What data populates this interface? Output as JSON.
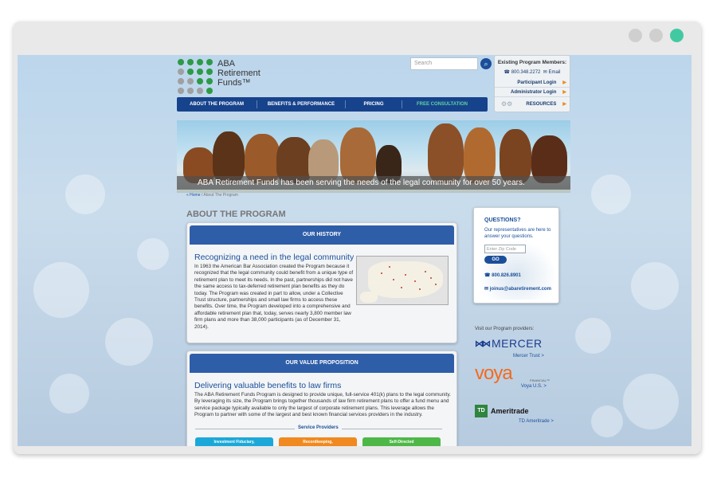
{
  "window": {
    "controls": [
      "window-dot",
      "window-dot",
      "window-dot-active"
    ]
  },
  "logo": {
    "line1": "ABA",
    "line2": "Retirement",
    "line3": "Funds™"
  },
  "search": {
    "placeholder": "Search"
  },
  "members": {
    "title": "Existing Program Members:",
    "phone": "800.348.2272",
    "email": "Email",
    "participant_login": "Participant Login",
    "administrator_login": "Administrator Login",
    "resources": "RESOURCES"
  },
  "nav": {
    "items": [
      "ABOUT THE PROGRAM",
      "BENEFITS & PERFORMANCE",
      "PRICING",
      "FREE CONSULTATION"
    ]
  },
  "hero": {
    "caption": "ABA Retirement Funds has been serving the needs of the legal community for over 50 years."
  },
  "breadcrumb": {
    "home": "« Home",
    "sep": "/",
    "current": "About The Program"
  },
  "page": {
    "title": "ABOUT THE PROGRAM"
  },
  "history": {
    "header": "OUR HISTORY",
    "title": "Recognizing a need in the legal community",
    "body": "In 1963 the American Bar Association created the Program because it recognized that the legal community could benefit from a unique type of retirement plan to meet its needs. In the past, partnerships did not have the same access to tax-deferred retirement plan benefits as they do today. The Program was created in part to allow, under a Collective Trust structure, partnerships and small law firms to access these benefits. Over time, the Program developed into a comprehensive and affordable retirement plan that, today, serves nearly 3,800 member law firm plans and more than 38,000 participants (as of December 31, 2014)."
  },
  "value": {
    "header": "OUR VALUE PROPOSITION",
    "title": "Delivering valuable benefits to law firms",
    "body": "The ABA Retirement Funds Program is designed to provide unique, full-service 401(k) plans to the legal community. By leveraging its size, the Program brings together thousands of law firm retirement plans to offer a fund menu and service package typically available to only the largest of corporate retirement plans. This leverage allows the Program to partner with some of the largest and best known financial services providers in the industry.",
    "service_providers": "Service Providers",
    "pills": [
      {
        "label": "Investment Fiduciary,",
        "color": "#1ba8d8"
      },
      {
        "label": "Recordkeeping,",
        "color": "#f0891f"
      },
      {
        "label": "Self-Directed",
        "color": "#4db848"
      }
    ]
  },
  "questions": {
    "title": "QUESTIONS?",
    "desc": "Our representatives are here to answer your questions.",
    "zip_placeholder": "Enter Zip Code",
    "go": "GO",
    "phone": "800.826.8901",
    "email": "joinus@abaretirement.com"
  },
  "providers": {
    "heading": "Visit our Program providers:",
    "mercer": {
      "logo": "MERCER",
      "link": "Mercer Trust >"
    },
    "voya": {
      "logo": "voya",
      "sub": "FINANCIAL™",
      "link": "Voya U.S. >"
    },
    "td": {
      "logo": "Ameritrade",
      "box": "TD",
      "link": "TD Ameritrade >"
    }
  }
}
